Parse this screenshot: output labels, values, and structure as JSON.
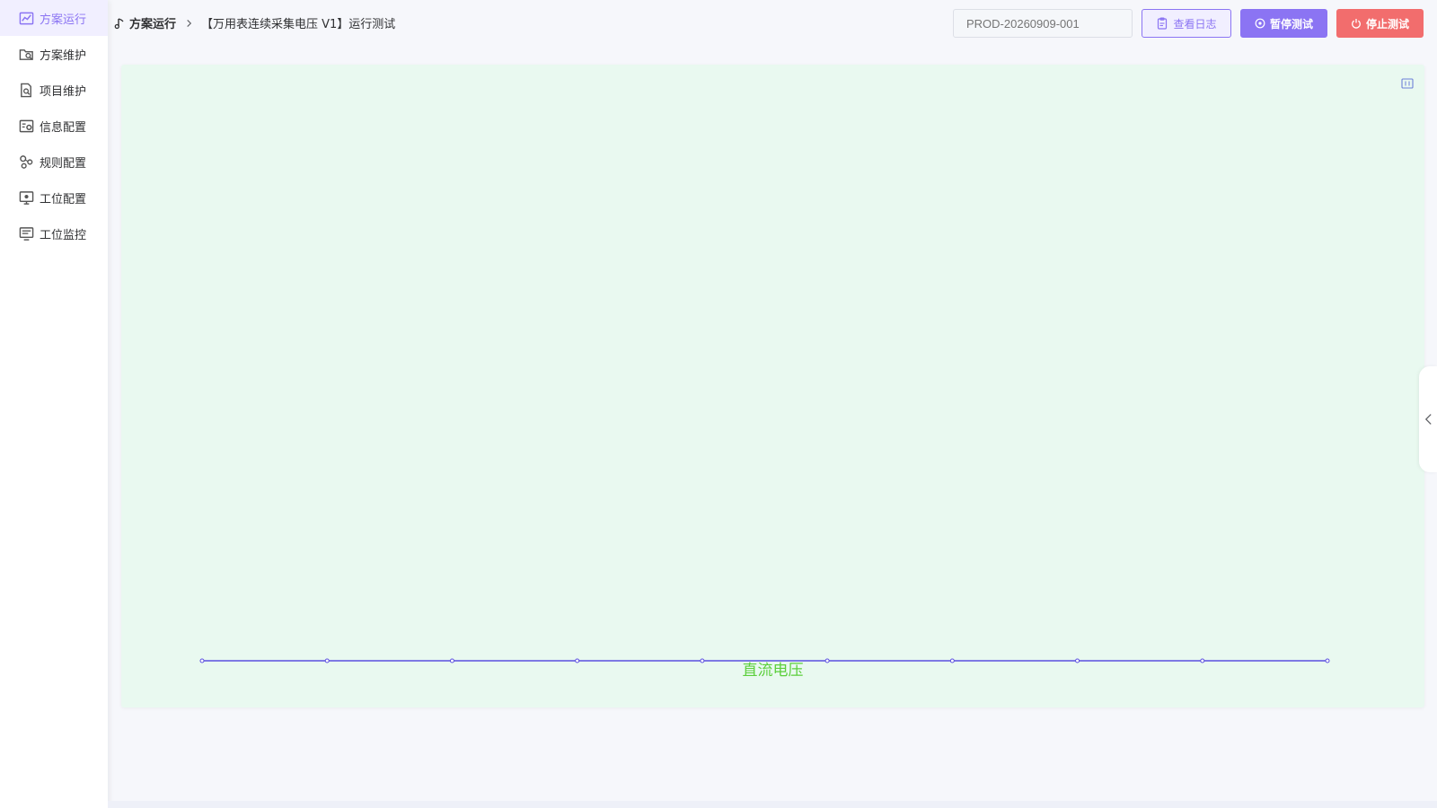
{
  "sidebar": {
    "items": [
      {
        "label": "方案运行",
        "icon": "trend-chart-icon",
        "active": true
      },
      {
        "label": "方案维护",
        "icon": "folder-search-icon",
        "active": false
      },
      {
        "label": "项目维护",
        "icon": "document-search-icon",
        "active": false
      },
      {
        "label": "信息配置",
        "icon": "settings-list-icon",
        "active": false
      },
      {
        "label": "规则配置",
        "icon": "rules-nodes-icon",
        "active": false
      },
      {
        "label": "工位配置",
        "icon": "monitor-gear-icon",
        "active": false
      },
      {
        "label": "工位监控",
        "icon": "monitor-list-icon",
        "active": false
      }
    ]
  },
  "header": {
    "breadcrumb": {
      "root": "方案运行",
      "current": "【万用表连续采集电压 V1】运行测试"
    },
    "code_input": {
      "value": "",
      "placeholder": "PROD-20260909-001"
    },
    "buttons": {
      "view_log": "查看日志",
      "pause": "暂停测试",
      "stop": "停止测试"
    }
  },
  "colors": {
    "accent": "#8b74f3",
    "danger": "#f26d6d",
    "chart_bg": "#e9f9f0",
    "series_line": "#5b4fe0",
    "title_green": "#5ccf3c"
  },
  "chart_data": {
    "type": "line",
    "title": "直流电压",
    "series": [
      {
        "values": [
          0,
          0,
          0,
          0,
          0,
          0,
          0,
          0,
          0,
          0
        ]
      }
    ],
    "grid": false,
    "legend": "none"
  }
}
